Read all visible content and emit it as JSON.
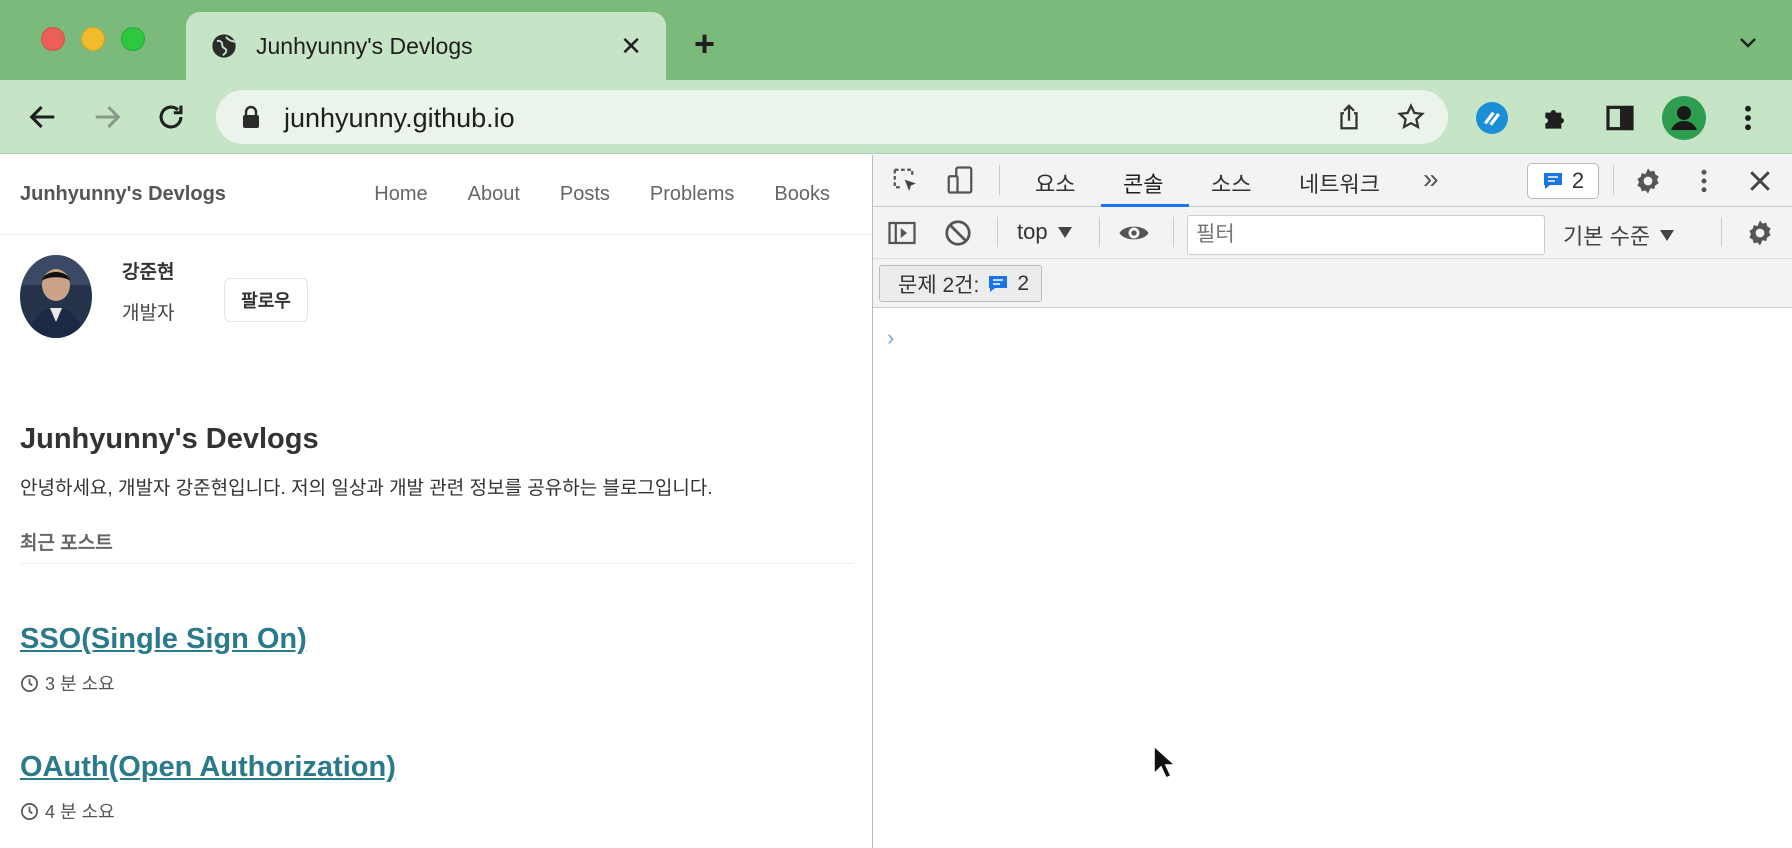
{
  "browser": {
    "tab_title": "Junhyunny's Devlogs",
    "url": "junhyunny.github.io",
    "new_tab_label": "+",
    "close_label": "✕",
    "icons": [
      "globe-icon",
      "close-icon",
      "chevron-down-icon",
      "back-arrow-icon",
      "forward-arrow-icon",
      "reload-icon",
      "lock-icon",
      "share-icon",
      "star-icon",
      "extension-icon",
      "puzzle-icon",
      "sidebar-icon",
      "profile-icon",
      "kebab-menu-icon"
    ]
  },
  "site": {
    "title": "Junhyunny's Devlogs",
    "nav": [
      "Home",
      "About",
      "Posts",
      "Problems",
      "Books"
    ]
  },
  "author": {
    "name": "강준현",
    "role": "개발자",
    "follow_label": "팔로우"
  },
  "main": {
    "heading": "Junhyunny's Devlogs",
    "description": "안녕하세요, 개발자 강준현입니다. 저의 일상과 개발 관련 정보를 공유하는 블로그입니다.",
    "recent_label": "최근 포스트",
    "posts": [
      {
        "title": "SSO(Single Sign On)",
        "read_time": "3 분 소요"
      },
      {
        "title": "OAuth(Open Authorization)",
        "read_time": "4 분 소요"
      }
    ]
  },
  "devtools": {
    "tabs": [
      "요소",
      "콘솔",
      "소스",
      "네트워크"
    ],
    "active_tab": "콘솔",
    "more_tabs": "»",
    "issues_count": "2",
    "context": "top",
    "filter_placeholder": "필터",
    "log_level": "기본 수준",
    "issues_label": "문제 2건:",
    "issues_chip_count": "2",
    "prompt": "›"
  },
  "colors": {
    "tabstrip": "#7aba7a",
    "toolbar": "#c6e5c6",
    "link": "#2a7a8c",
    "devtools_accent": "#1a73e8"
  }
}
